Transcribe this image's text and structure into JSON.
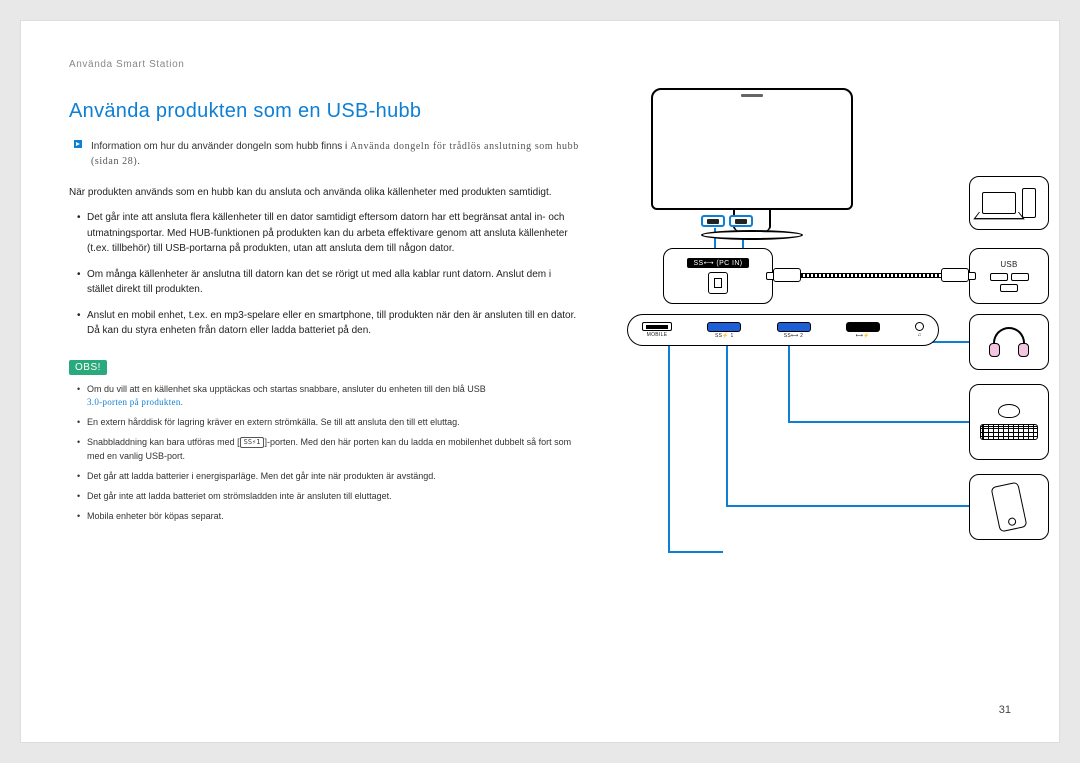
{
  "breadcrumb": "Använda Smart Station",
  "title": "Använda produkten som en USB-hubb",
  "info_line": "Information om hur du använder dongeln som hubb finns i ",
  "info_ref": "Använda dongeln för trådlös anslutning som hubb (sidan 28)",
  "info_tail": ".",
  "intro": "När produkten används som en hubb kan du ansluta och använda olika källenheter med produkten samtidigt.",
  "bullets": [
    "Det går inte att ansluta flera källenheter till en dator samtidigt eftersom datorn har ett begränsat antal in- och utmatningsportar. Med HUB-funktionen på produkten kan du arbeta effektivare genom att ansluta källenheter (t.ex. tillbehör) till USB-portarna på produkten, utan att ansluta dem till någon dator.",
    "Om många källenheter är anslutna till datorn kan det se rörigt ut med alla kablar runt datorn. Anslut dem i stället direkt till produkten.",
    "Anslut en mobil enhet, t.ex. en mp3-spelare eller en smartphone, till produkten när den är ansluten till en dator. Då kan du styra enheten från datorn eller ladda batteriet på den."
  ],
  "obs_label": "OBS!",
  "notes": {
    "n1a": "Om du vill att en källenhet ska upptäckas och startas snabbare, ansluter du enheten till den blå USB ",
    "n1b": "3.0-porten på produkten.",
    "n2": "En extern hårddisk för lagring kräver en extern strömkälla. Se till att ansluta den till ett eluttag.",
    "n3a": "Snabbladdning kan bara utföras med [",
    "n3_icon": "SS⚡1",
    "n3b": "]-porten. Med den här porten kan du ladda en mobilenhet dubbelt så fort som med en vanlig USB-port.",
    "n4": "Det går att ladda batterier i energisparläge. Men det går inte när produkten är avstängd.",
    "n5": "Det går inte att ladda batteriet om strömsladden inte är ansluten till eluttaget.",
    "n6": "Mobila enheter bör köpas separat."
  },
  "page_number": "31",
  "diagram": {
    "pcin_label": "SS⟷ (PC IN)",
    "usb_label": "USB",
    "hub_ports": {
      "mobile": "MOBILE",
      "ss1": "SS⚡ 1",
      "ss2": "SS⟷ 2",
      "charge": "⟷⚡",
      "audio": "♫"
    }
  }
}
